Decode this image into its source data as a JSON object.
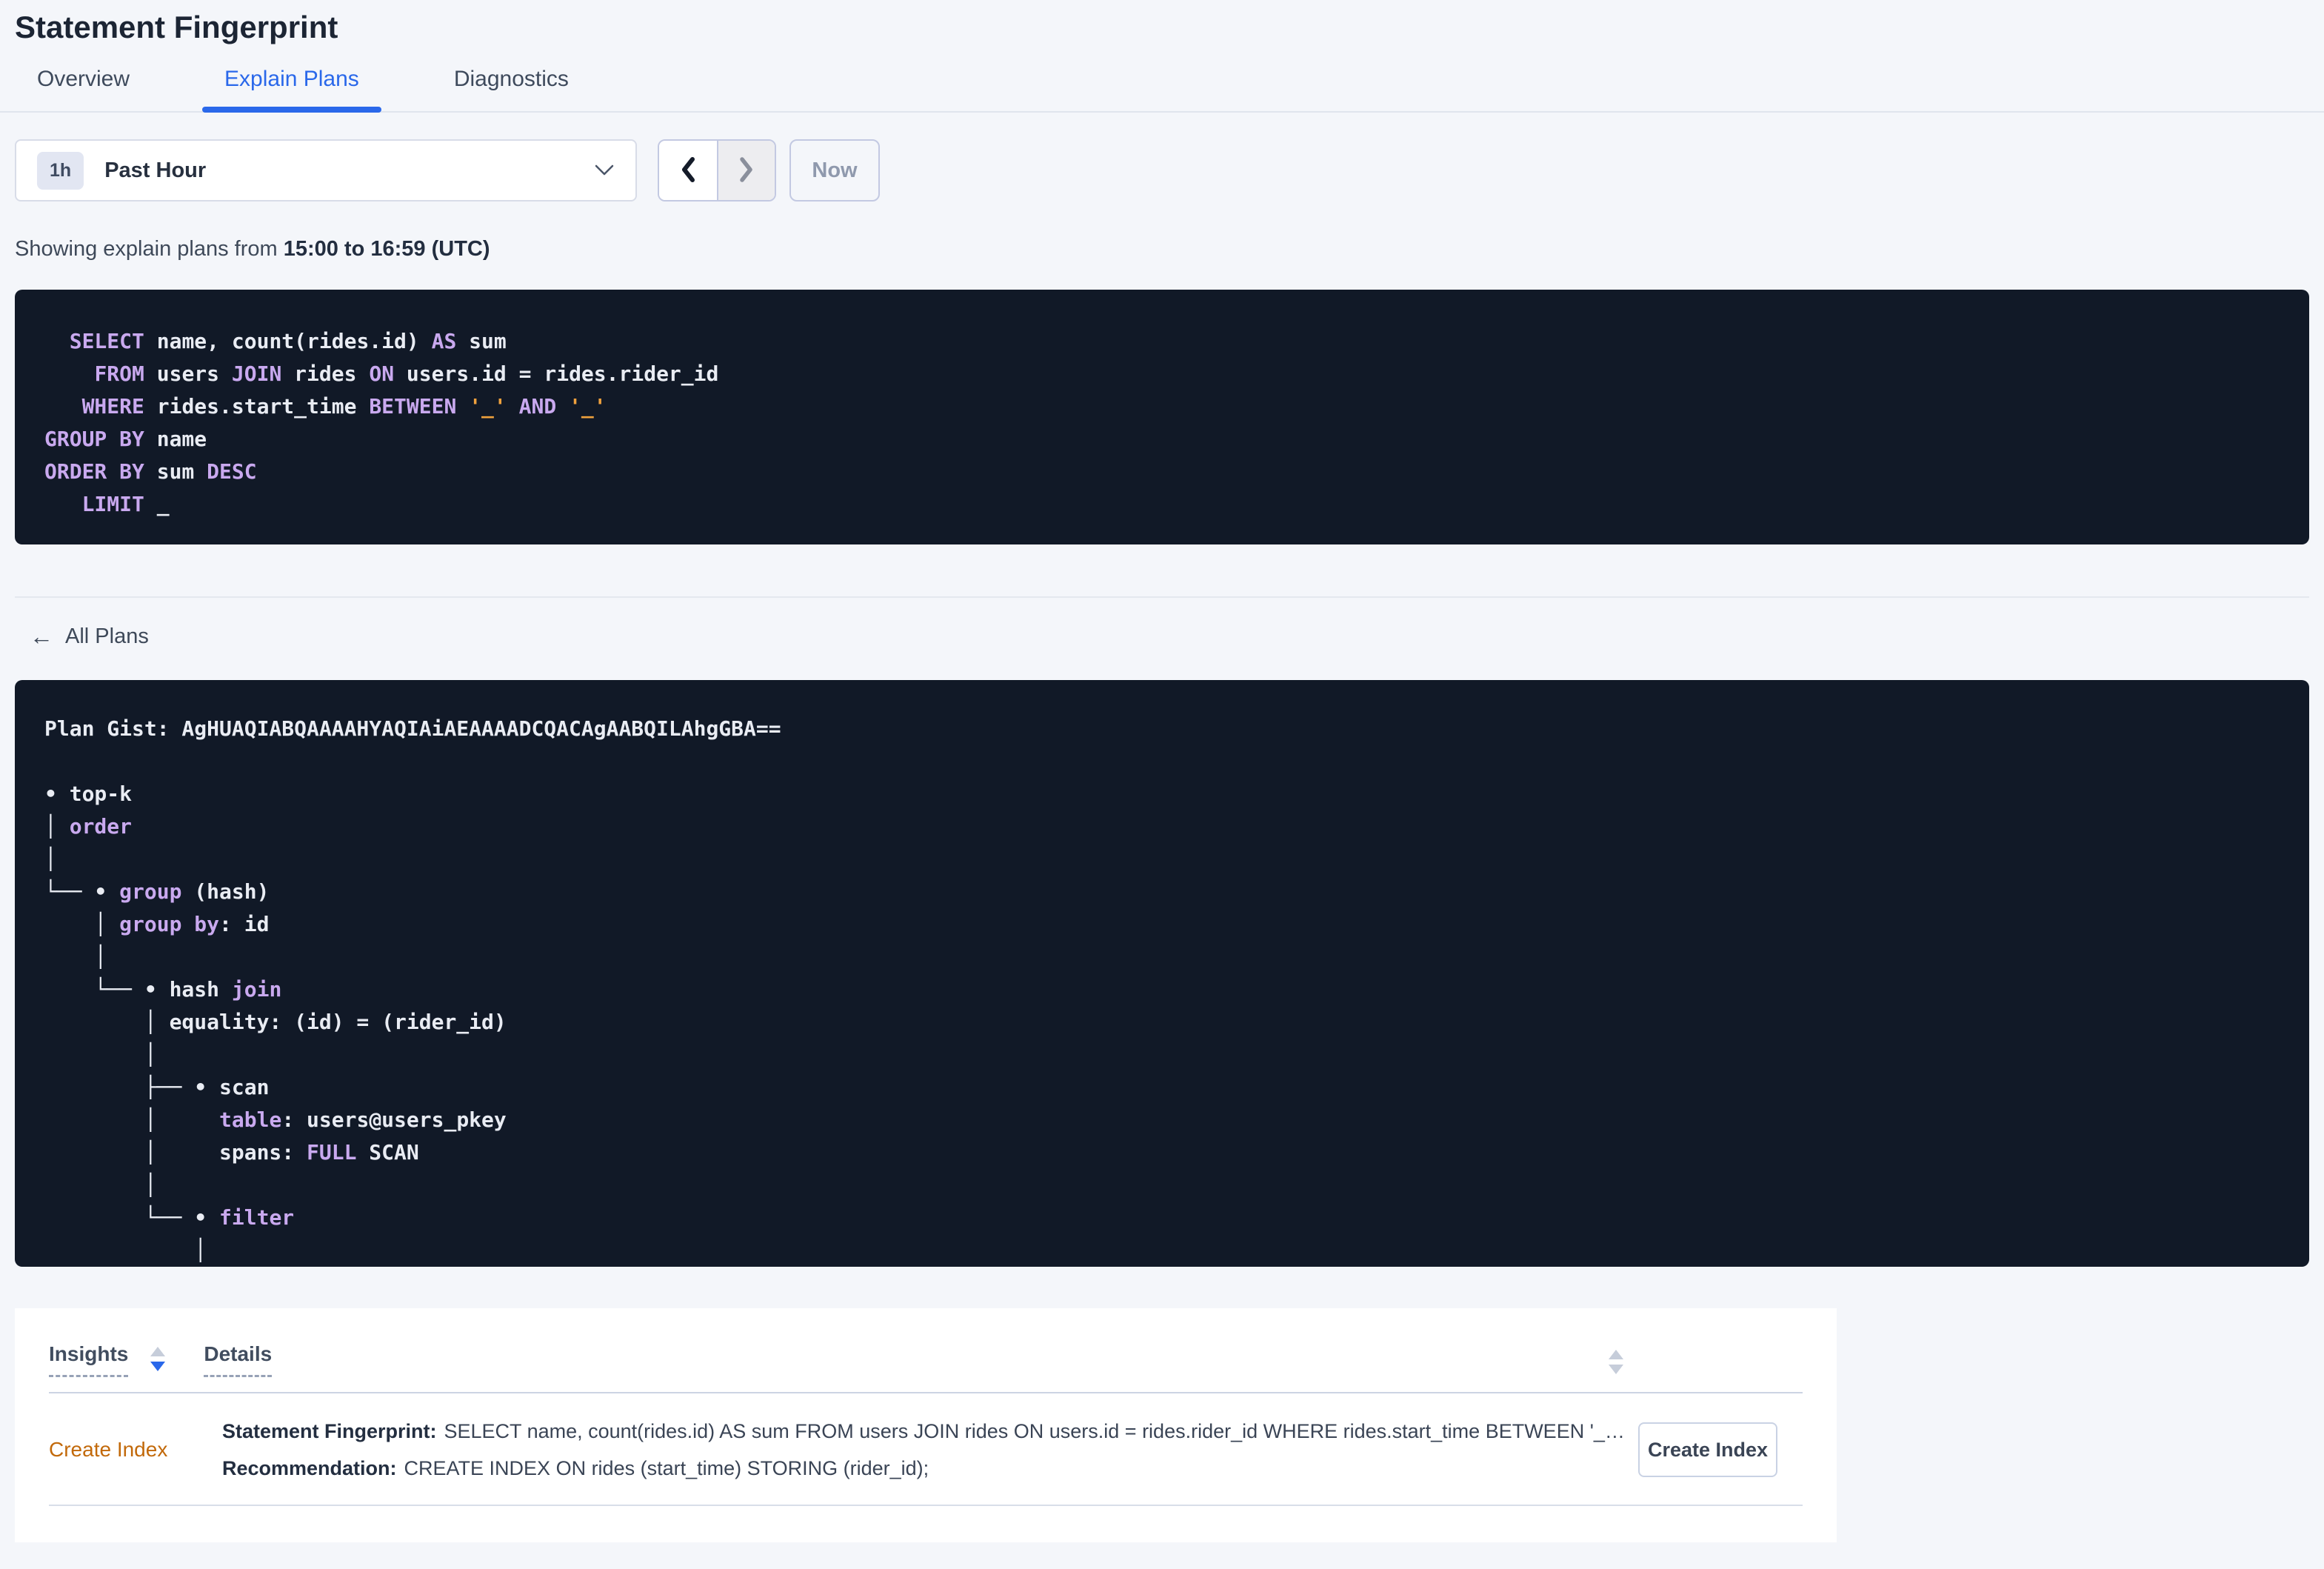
{
  "colors": {
    "accent-blue": "#2a68ea",
    "code-bg": "#111927",
    "keyword-purple": "#c9a9ef",
    "placeholder-orange": "#efa13d",
    "insight-orange": "#c2690a"
  },
  "header": {
    "title": "Statement Fingerprint"
  },
  "tabs": [
    {
      "label": "Overview",
      "active": false
    },
    {
      "label": "Explain Plans",
      "active": true
    },
    {
      "label": "Diagnostics",
      "active": false
    }
  ],
  "time_picker": {
    "badge": "1h",
    "label": "Past Hour",
    "now_label": "Now",
    "prev_enabled": true,
    "next_enabled": false
  },
  "showing": {
    "prefix": "Showing explain plans from ",
    "range": "15:00 to 16:59 (UTC)"
  },
  "sql_statement": {
    "lines": [
      [
        {
          "t": "  "
        },
        {
          "t": "SELECT",
          "c": "kw"
        },
        {
          "t": " name, count(rides.id) "
        },
        {
          "t": "AS",
          "c": "kw"
        },
        {
          "t": " sum"
        }
      ],
      [
        {
          "t": "    "
        },
        {
          "t": "FROM",
          "c": "kw"
        },
        {
          "t": " users "
        },
        {
          "t": "JOIN",
          "c": "kw"
        },
        {
          "t": " rides "
        },
        {
          "t": "ON",
          "c": "kw"
        },
        {
          "t": " users.id = rides.rider_id"
        }
      ],
      [
        {
          "t": "   "
        },
        {
          "t": "WHERE",
          "c": "kw"
        },
        {
          "t": " rides.start_time "
        },
        {
          "t": "BETWEEN",
          "c": "kw"
        },
        {
          "t": " "
        },
        {
          "t": "'_'",
          "c": "ph"
        },
        {
          "t": " "
        },
        {
          "t": "AND",
          "c": "kw"
        },
        {
          "t": " "
        },
        {
          "t": "'_'",
          "c": "ph"
        }
      ],
      [
        {
          "t": "GROUP BY",
          "c": "kw"
        },
        {
          "t": " name"
        }
      ],
      [
        {
          "t": "ORDER BY",
          "c": "kw"
        },
        {
          "t": " sum "
        },
        {
          "t": "DESC",
          "c": "kw"
        }
      ],
      [
        {
          "t": "   "
        },
        {
          "t": "LIMIT",
          "c": "kw"
        },
        {
          "t": " _"
        }
      ]
    ]
  },
  "back_link": {
    "label": "All Plans"
  },
  "plan_gist": {
    "lines": [
      [
        {
          "t": "Plan Gist: AgHUAQIABQAAAAHYAQIAiAEAAAADCQACAgAABQILAhgGBA=="
        }
      ],
      [
        {
          "t": ""
        }
      ],
      [
        {
          "t": "• top-k"
        }
      ],
      [
        {
          "t": "│ "
        },
        {
          "t": "order",
          "c": "kw"
        }
      ],
      [
        {
          "t": "│"
        }
      ],
      [
        {
          "t": "└── • "
        },
        {
          "t": "group",
          "c": "kw"
        },
        {
          "t": " (hash)"
        }
      ],
      [
        {
          "t": "    │ "
        },
        {
          "t": "group by",
          "c": "kw"
        },
        {
          "t": ": id"
        }
      ],
      [
        {
          "t": "    │"
        }
      ],
      [
        {
          "t": "    └── • hash "
        },
        {
          "t": "join",
          "c": "kw"
        }
      ],
      [
        {
          "t": "        │ equality: (id) = (rider_id)"
        }
      ],
      [
        {
          "t": "        │"
        }
      ],
      [
        {
          "t": "        ├── • scan"
        }
      ],
      [
        {
          "t": "        │     "
        },
        {
          "t": "table",
          "c": "kw"
        },
        {
          "t": ": users@users_pkey"
        }
      ],
      [
        {
          "t": "        │     spans: "
        },
        {
          "t": "FULL",
          "c": "kw"
        },
        {
          "t": " SCAN"
        }
      ],
      [
        {
          "t": "        │"
        }
      ],
      [
        {
          "t": "        └── • "
        },
        {
          "t": "filter",
          "c": "kw"
        }
      ],
      [
        {
          "t": "            │"
        }
      ]
    ]
  },
  "insights_table": {
    "columns": [
      {
        "label": "Insights",
        "sortable": true,
        "sort": "desc"
      },
      {
        "label": "Details",
        "sortable": true,
        "sort": "none"
      }
    ],
    "row": {
      "insight": "Create Index",
      "fingerprint_label": "Statement Fingerprint:",
      "fingerprint_value": "SELECT name, count(rides.id) AS sum FROM users JOIN rides ON users.id = rides.rider_id WHERE rides.start_time BETWEEN '_…",
      "recommendation_label": "Recommendation:",
      "recommendation_value": "CREATE INDEX ON rides (start_time) STORING (rider_id);",
      "action_label": "Create Index"
    }
  }
}
